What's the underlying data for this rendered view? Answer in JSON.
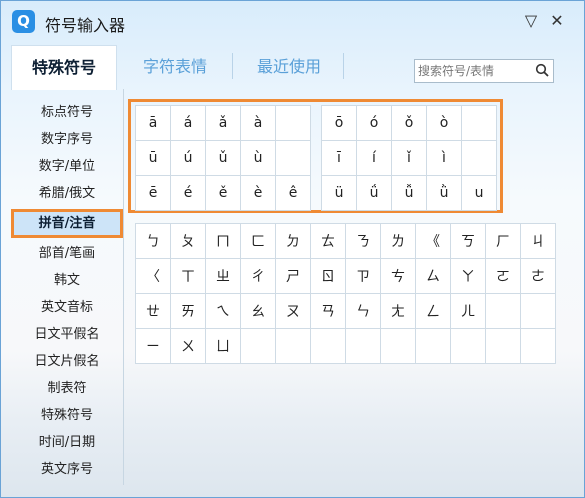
{
  "window": {
    "title": "符号输入器",
    "logo_letter": "Q"
  },
  "controls": {
    "more": "▽",
    "close": "✕"
  },
  "tabs": [
    {
      "label": "特殊符号",
      "active": true
    },
    {
      "label": "字符表情",
      "active": false
    },
    {
      "label": "最近使用",
      "active": false
    }
  ],
  "search": {
    "placeholder": "搜索符号/表情",
    "icon": "search-icon"
  },
  "sidebar": {
    "items": [
      {
        "label": "标点符号"
      },
      {
        "label": "数字序号"
      },
      {
        "label": "数字/单位"
      },
      {
        "label": "希腊/俄文"
      },
      {
        "label": "拼音/注音",
        "active": true
      },
      {
        "label": "部首/笔画"
      },
      {
        "label": "韩文"
      },
      {
        "label": "英文音标"
      },
      {
        "label": "日文平假名"
      },
      {
        "label": "日文片假名"
      },
      {
        "label": "制表符"
      },
      {
        "label": "特殊符号"
      },
      {
        "label": "时间/日期"
      },
      {
        "label": "英文序号"
      }
    ]
  },
  "pinyin_left": [
    [
      "ā",
      "á",
      "ǎ",
      "à",
      ""
    ],
    [
      "ū",
      "ú",
      "ǔ",
      "ù",
      ""
    ],
    [
      "ē",
      "é",
      "ě",
      "è",
      "ê"
    ]
  ],
  "pinyin_right": [
    [
      "ō",
      "ó",
      "ǒ",
      "ò",
      ""
    ],
    [
      "ī",
      "í",
      "ǐ",
      "ì",
      ""
    ],
    [
      "ü",
      "ǘ",
      "ǚ",
      "ǜ",
      "u"
    ]
  ],
  "zhuyin": [
    [
      "ㄅ",
      "ㄆ",
      "ㄇ",
      "ㄈ",
      "ㄉ",
      "ㄊ",
      "ㄋ",
      "ㄌ",
      "《",
      "ㄎ",
      "ㄏ",
      "ㄐ"
    ],
    [
      "〈",
      "ㄒ",
      "ㄓ",
      "ㄔ",
      "ㄕ",
      "ㄖ",
      "ㄗ",
      "ㄘ",
      "ㄙ",
      "ㄚ",
      "ㄛ",
      "ㄜ"
    ],
    [
      "ㄝ",
      "ㄞ",
      "ㄟ",
      "ㄠ",
      "ㄡ",
      "ㄢ",
      "ㄣ",
      "ㄤ",
      "ㄥ",
      "ㄦ",
      "",
      ""
    ],
    [
      "ㄧ",
      "ㄨ",
      "ㄩ",
      "",
      "",
      "",
      "",
      "",
      "",
      "",
      "",
      ""
    ]
  ],
  "colors": {
    "highlight": "#ef8a34",
    "accent": "#2a8fe4",
    "active_tab_text": "#0d1f33",
    "inactive_tab_text": "#5aa0d8"
  }
}
